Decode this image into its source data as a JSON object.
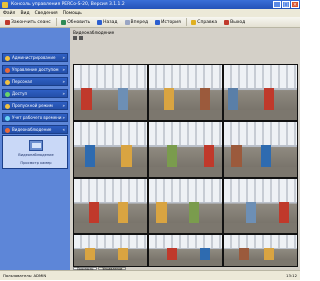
{
  "window": {
    "title": "Консоль управления PERCo-S-20, Версия 3.1.1.2"
  },
  "menu": [
    "Файл",
    "Вид",
    "Сведения",
    "Помощь"
  ],
  "toolbar": {
    "buttons": [
      {
        "label": "Закончить сеанс",
        "icon": "logout-icon",
        "color": "#c0392b"
      },
      {
        "label": "Обновить",
        "icon": "refresh-icon",
        "color": "#2e8b57"
      },
      {
        "label": "Назад",
        "icon": "back-arrow-icon",
        "color": "#2c5fd0"
      },
      {
        "label": "Вперед",
        "icon": "forward-arrow-icon",
        "color": "#9aa6c4"
      },
      {
        "label": "История",
        "icon": "history-icon",
        "color": "#2c5fd0"
      },
      {
        "label": "Справка",
        "icon": "help-icon",
        "color": "#e0b020"
      },
      {
        "label": "Выход",
        "icon": "exit-icon",
        "color": "#c0392b"
      }
    ]
  },
  "sidebar": {
    "items": [
      {
        "label": "Администрирование",
        "color": "#f0c040"
      },
      {
        "label": "Управление доступом",
        "color": "#e86a3a"
      },
      {
        "label": "Персонал",
        "color": "#f0c040"
      },
      {
        "label": "Доступ",
        "color": "#6ad36a"
      },
      {
        "label": "Пропускной режим",
        "color": "#f0c040"
      },
      {
        "label": "Учет рабочего времени",
        "color": "#6ad3f0"
      },
      {
        "label": "Видеонаблюдение",
        "color": "#e86a3a"
      }
    ],
    "panel": {
      "label1": "Видеонаблюдение",
      "label2": "Просмотр камер"
    }
  },
  "content": {
    "title": "Видеонаблюдение",
    "tabs": [
      {
        "label": "Просмотр",
        "active": true
      },
      {
        "label": "Управление",
        "active": false
      }
    ]
  },
  "status": {
    "left": "Пользователь:   ADMIN",
    "right": "13:12"
  }
}
